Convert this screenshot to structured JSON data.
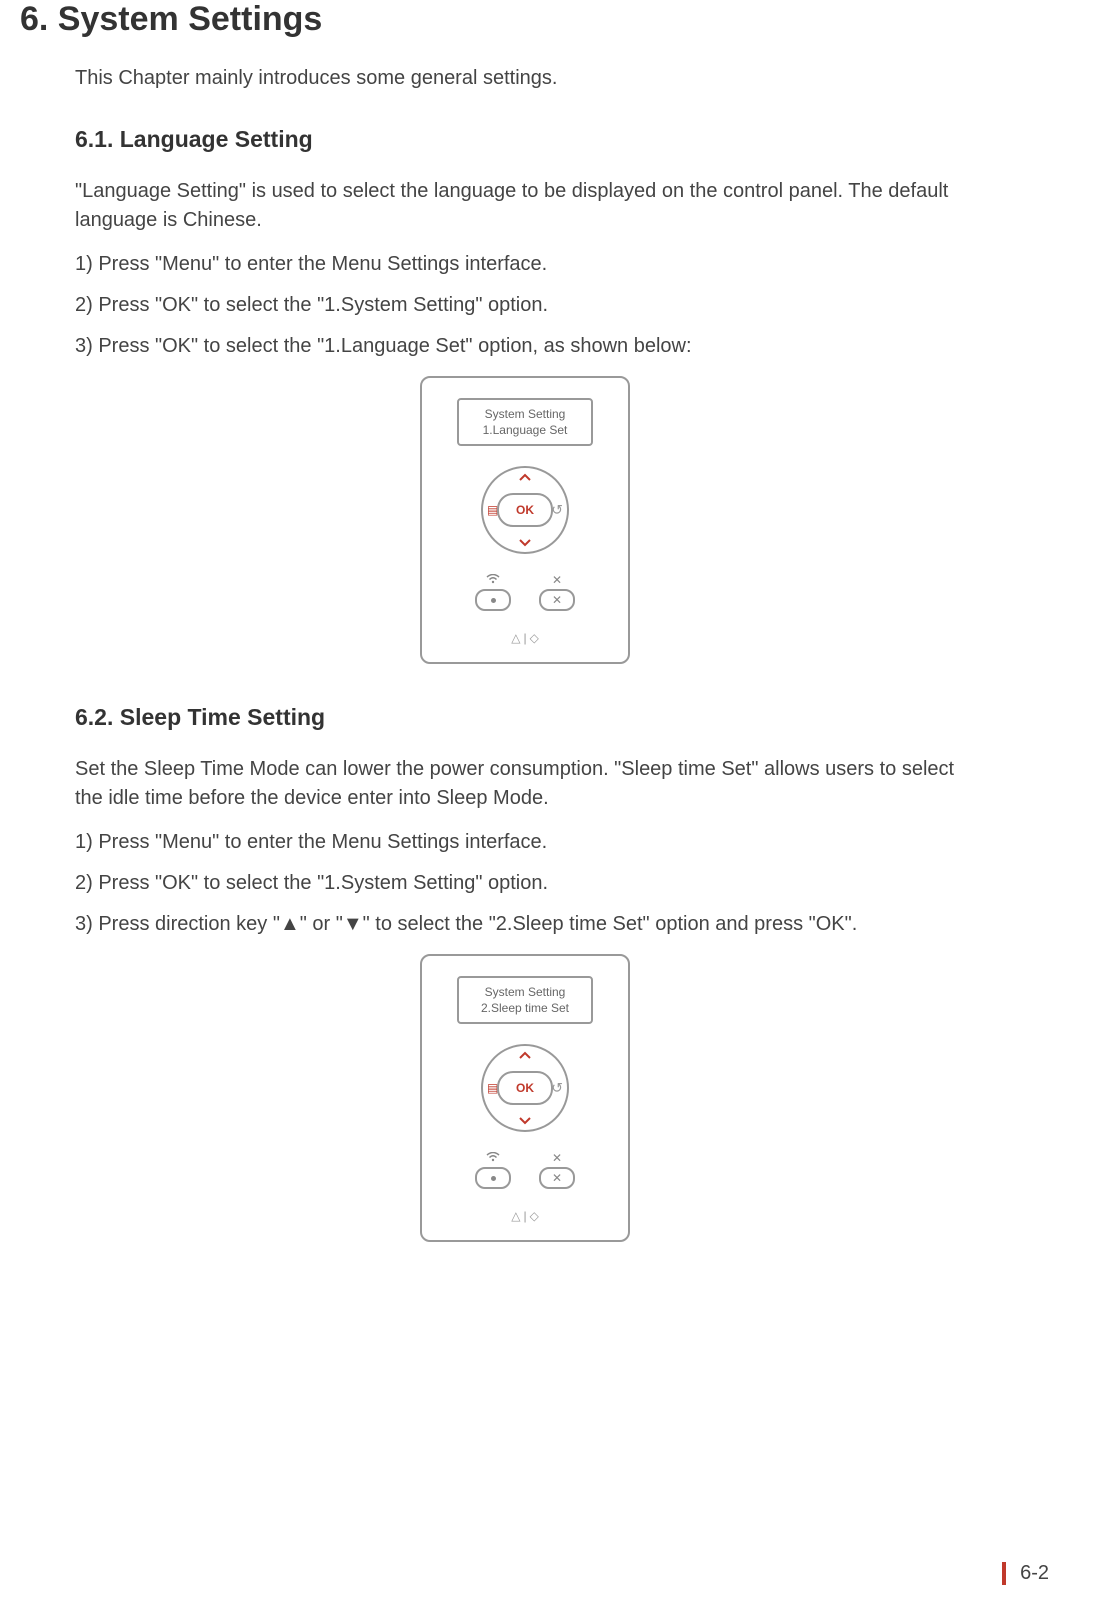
{
  "chapter": {
    "title": "6. System Settings",
    "intro": "This Chapter mainly introduces some general settings."
  },
  "section_6_1": {
    "heading": "6.1. Language Setting",
    "para": "\"Language Setting\" is used to select the language to be displayed on the control panel. The default language is Chinese.",
    "steps": [
      "1) Press \"Menu\" to enter the Menu Settings interface.",
      "2) Press \"OK\" to select the \"1.System Setting\" option.",
      "3) Press \"OK\" to select the \"1.Language Set\" option, as shown below:"
    ],
    "panel": {
      "lcd_line1": "System Setting",
      "lcd_line2": "1.Language Set",
      "ok_label": "OK"
    }
  },
  "section_6_2": {
    "heading": "6.2. Sleep Time Setting",
    "para": "Set the Sleep Time Mode can lower the power consumption. \"Sleep time Set\" allows users to select the idle time before the device enter into Sleep Mode.",
    "steps": [
      "1) Press \"Menu\" to enter the Menu Settings interface.",
      "2) Press \"OK\" to select the \"1.System Setting\" option.",
      "3) Press direction key \"▲\" or \"▼\" to select the \"2.Sleep time Set\" option and press \"OK\"."
    ],
    "panel": {
      "lcd_line1": "System Setting",
      "lcd_line2": "2.Sleep time Set",
      "ok_label": "OK"
    }
  },
  "page_number": "6-2"
}
